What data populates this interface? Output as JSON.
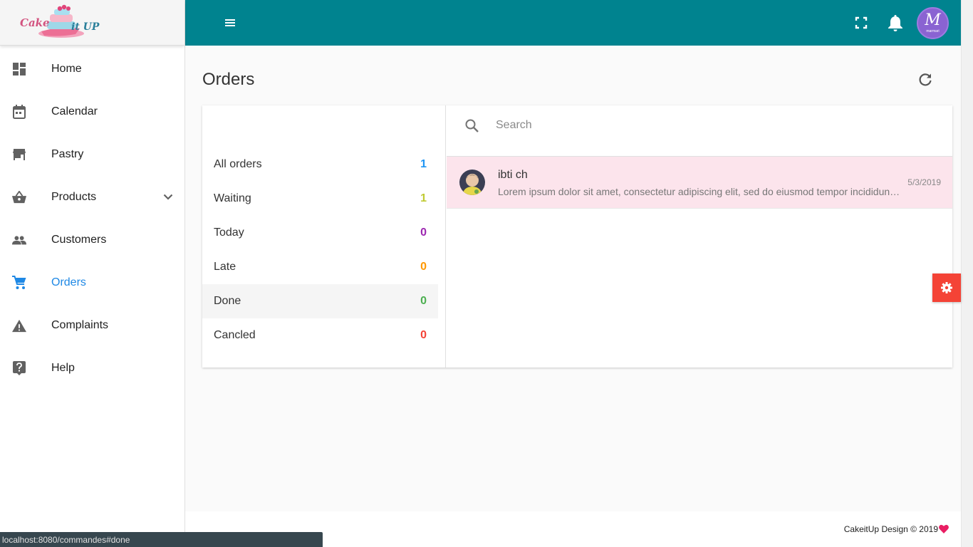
{
  "brand": {
    "name_part1": "Cake",
    "name_part2": "it UP"
  },
  "sidebar": {
    "items": [
      {
        "label": "Home",
        "icon": "dashboard-icon"
      },
      {
        "label": "Calendar",
        "icon": "calendar-icon"
      },
      {
        "label": "Pastry",
        "icon": "store-icon"
      },
      {
        "label": "Products",
        "icon": "basket-icon"
      },
      {
        "label": "Customers",
        "icon": "people-icon"
      },
      {
        "label": "Orders",
        "icon": "cart-icon"
      },
      {
        "label": "Complaints",
        "icon": "warning-icon"
      },
      {
        "label": "Help",
        "icon": "help-icon"
      }
    ],
    "active": "Orders"
  },
  "header": {
    "avatar_letter": "M",
    "avatar_sub": "marmari"
  },
  "main": {
    "title": "Orders"
  },
  "filters": [
    {
      "label": "All orders",
      "count": "1",
      "color": "#2196f3"
    },
    {
      "label": "Waiting",
      "count": "1",
      "color": "#c0ca33"
    },
    {
      "label": "Today",
      "count": "0",
      "color": "#9c27b0"
    },
    {
      "label": "Late",
      "count": "0",
      "color": "#ff9800"
    },
    {
      "label": "Done",
      "count": "0",
      "color": "#4caf50"
    },
    {
      "label": "Cancled",
      "count": "0",
      "color": "#f44336"
    }
  ],
  "selected_filter": "Done",
  "search": {
    "placeholder": "Search",
    "value": ""
  },
  "orders": [
    {
      "name": "ibti ch",
      "snippet": "Lorem ipsum dolor sit amet, consectetur adipiscing elit, sed do eiusmod tempor incididunt ut labore et dolore magna aliqua.",
      "date": "5/3/2019"
    }
  ],
  "footer": {
    "text": "CakeitUp Design © 2019"
  },
  "status_bar": {
    "url": "localhost:8080/commandes#done"
  },
  "colors": {
    "topbar": "#00838f",
    "accent": "#1e88e5",
    "selected_row": "#fce4ec",
    "fab": "#f44336",
    "heart": "#e91e63"
  }
}
